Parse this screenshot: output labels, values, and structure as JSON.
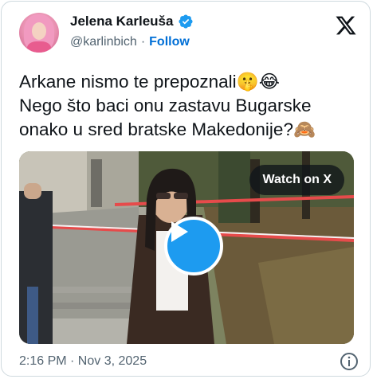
{
  "author": {
    "display_name": "Jelena Karleuša",
    "handle": "@karlinbich",
    "separator": "·",
    "follow_label": "Follow"
  },
  "tweet": {
    "text": "Arkane nismo te prepoznali🤫😂\nNego što baci onu zastavu Bugarske\nonako u sred bratske Makedonije?🙈"
  },
  "media": {
    "watch_label": "Watch on X"
  },
  "meta": {
    "timestamp": "2:16 PM · Nov 3, 2025"
  },
  "colors": {
    "accent": "#1d9bf0",
    "follow": "#006fd6",
    "muted": "#536471",
    "border": "#cfd9de"
  },
  "icons": {
    "verified": "verified-badge-icon",
    "logo": "x-logo-icon",
    "play": "play-icon",
    "info": "info-icon"
  }
}
